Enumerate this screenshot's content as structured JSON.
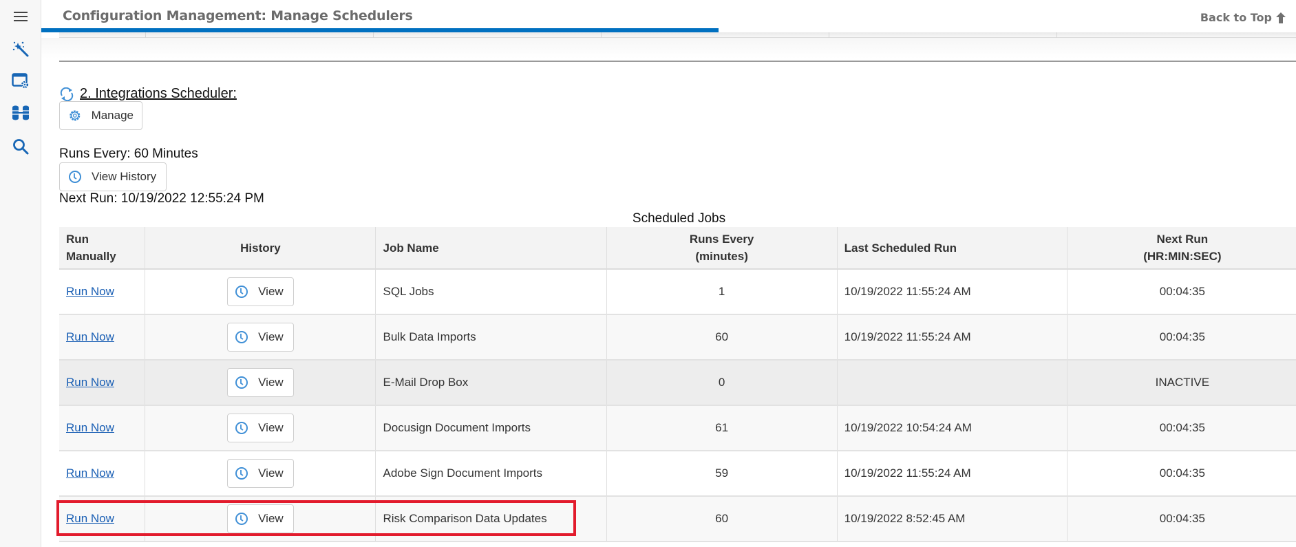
{
  "header": {
    "title": "Configuration Management: Manage Schedulers",
    "back_to_top": "Back to Top",
    "scroll_progress_percent": 54,
    "accent_color": "#0070c0"
  },
  "sidebar": {
    "items": [
      {
        "icon": "menu-icon"
      },
      {
        "icon": "magic-wand-icon"
      },
      {
        "icon": "window-settings-icon"
      },
      {
        "icon": "database-network-icon"
      },
      {
        "icon": "search-icon"
      }
    ]
  },
  "scheduler": {
    "heading": "2. Integrations Scheduler:",
    "manage_label": "Manage",
    "runs_every": "Runs Every: 60 Minutes",
    "view_history_label": "View History",
    "next_run": "Next Run: 10/19/2022 12:55:24 PM"
  },
  "table": {
    "caption": "Scheduled Jobs",
    "headers": {
      "run_manually_line1": "Run",
      "run_manually_line2": "Manually",
      "history": "History",
      "job_name": "Job Name",
      "runs_every_line1": "Runs Every",
      "runs_every_line2": "(minutes)",
      "last_scheduled_run": "Last Scheduled Run",
      "next_run_line1": "Next Run",
      "next_run_line2": "(HR:MIN:SEC)"
    },
    "rows": [
      {
        "run": "Run Now",
        "view": "View",
        "job_name": "SQL Jobs",
        "runs_every": "1",
        "last_run": "10/19/2022 11:55:24 AM",
        "next_run": "00:04:35"
      },
      {
        "run": "Run Now",
        "view": "View",
        "job_name": "Bulk Data Imports",
        "runs_every": "60",
        "last_run": "10/19/2022 11:55:24 AM",
        "next_run": "00:04:35"
      },
      {
        "run": "Run Now",
        "view": "View",
        "job_name": "E-Mail Drop Box",
        "runs_every": "0",
        "last_run": "",
        "next_run": "INACTIVE"
      },
      {
        "run": "Run Now",
        "view": "View",
        "job_name": "Docusign Document Imports",
        "runs_every": "61",
        "last_run": "10/19/2022 10:54:24 AM",
        "next_run": "00:04:35"
      },
      {
        "run": "Run Now",
        "view": "View",
        "job_name": "Adobe Sign Document Imports",
        "runs_every": "59",
        "last_run": "10/19/2022 11:55:24 AM",
        "next_run": "00:04:35"
      },
      {
        "run": "Run Now",
        "view": "View",
        "job_name": "Risk Comparison Data Updates",
        "runs_every": "60",
        "last_run": "10/19/2022 8:52:45 AM",
        "next_run": "00:04:35"
      }
    ]
  },
  "annotation": {
    "highlight_color": "#e21b2c",
    "highlighted_row": "Risk Comparison Data Updates"
  }
}
